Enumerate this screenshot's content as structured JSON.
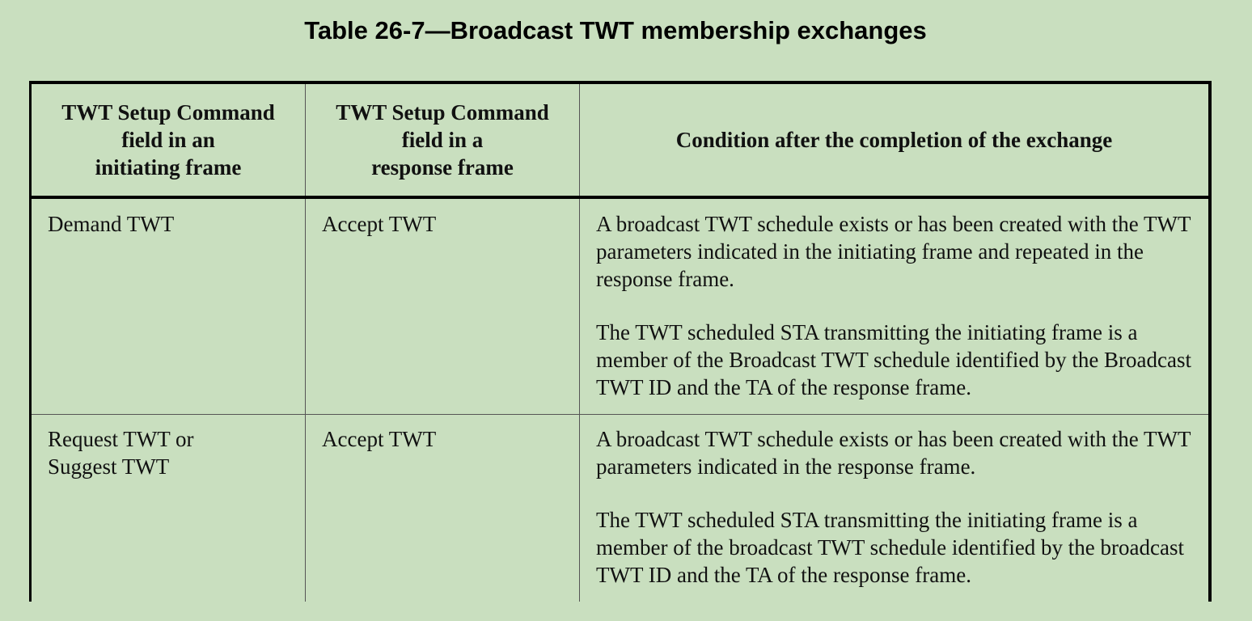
{
  "title": "Table 26-7—Broadcast TWT membership exchanges",
  "headers": [
    [
      "TWT Setup Command",
      "field in an",
      "initiating frame"
    ],
    [
      "TWT Setup Command",
      "field in a",
      "response frame"
    ],
    [
      "Condition after the completion of the exchange"
    ]
  ],
  "rows": [
    {
      "initiating": [
        "Demand TWT"
      ],
      "response": "Accept TWT",
      "condition": [
        "A broadcast TWT schedule exists or has been created with the TWT parameters indicated in the initiating frame and repeated in the response frame.",
        "The TWT scheduled STA transmitting the initiating frame is a member of the Broadcast TWT schedule identified by the Broadcast TWT ID and the TA of the response frame."
      ]
    },
    {
      "initiating": [
        "Request TWT or",
        "Suggest TWT"
      ],
      "response": "Accept TWT",
      "condition": [
        "A broadcast TWT schedule exists or has been created with the TWT parameters indicated in the response frame.",
        "The TWT scheduled STA transmitting the initiating frame is a member of the broadcast TWT schedule identified by the broadcast TWT ID and the TA of the response frame."
      ]
    }
  ]
}
